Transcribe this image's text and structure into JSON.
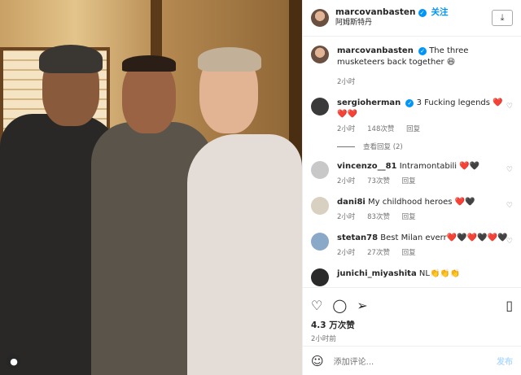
{
  "post": {
    "username": "marcovanbasten",
    "follow_label": "关注",
    "location": "阿姆斯特丹",
    "download_icon": "download-icon"
  },
  "caption": {
    "username": "marcovanbasten",
    "text": "The three musketeers back together 😆",
    "time": "2小时"
  },
  "comments": [
    {
      "username": "sergioherman",
      "verified": true,
      "text": "3 Fucking legends ❤️❤️❤️",
      "time": "2小时",
      "likes": "148次赞",
      "reply": "回复",
      "view_replies": "查看回复 (2)"
    },
    {
      "username": "vincenzo__81",
      "text": "Intramontabili ❤️🖤",
      "time": "2小时",
      "likes": "73次赞",
      "reply": "回复"
    },
    {
      "username": "dani8i",
      "text": "My childhood heroes ❤️🖤",
      "time": "2小时",
      "likes": "83次赞",
      "reply": "回复"
    },
    {
      "username": "stetan78",
      "text": "Best Milan everr❤️🖤❤️🖤❤️🖤",
      "time": "2小时",
      "likes": "27次赞",
      "reply": "回复"
    },
    {
      "username": "junichi_miyashita",
      "text": "NL👏👏👏"
    }
  ],
  "footer": {
    "likes": "4.3 万次赞",
    "time": "2小时前",
    "add_comment_placeholder": "添加评论...",
    "post_label": "发布"
  }
}
